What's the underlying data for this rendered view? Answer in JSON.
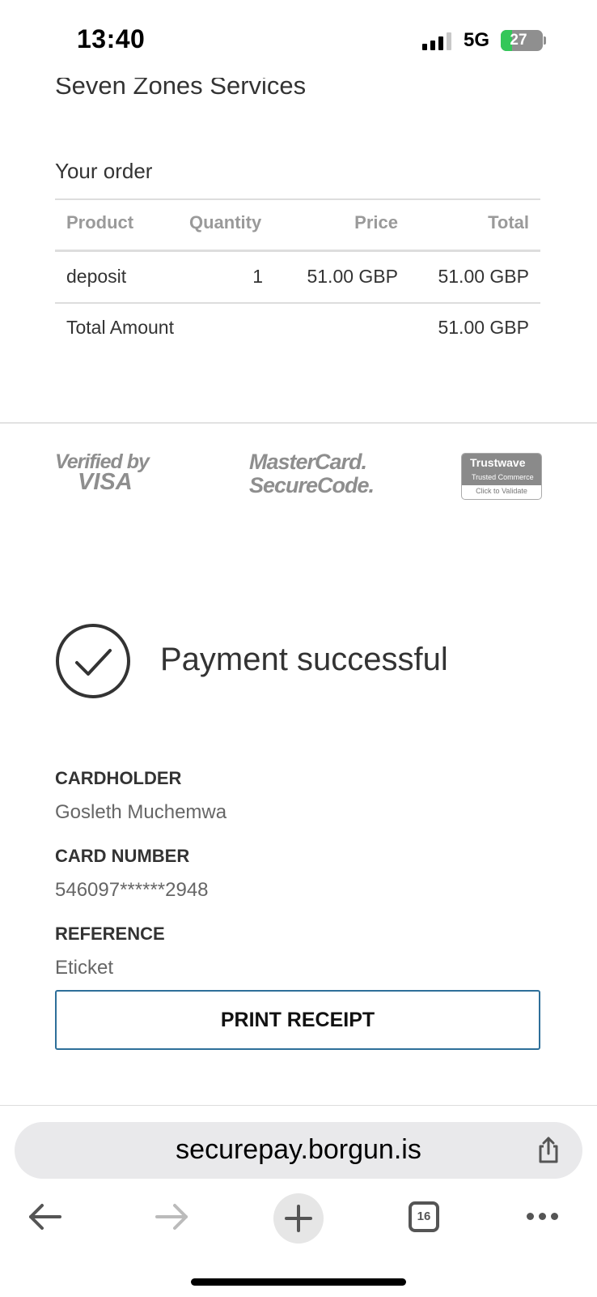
{
  "status_bar": {
    "time": "13:40",
    "network": "5G",
    "battery_level": 27,
    "battery_label": "27"
  },
  "merchant": {
    "name": "Seven Zones Services"
  },
  "order": {
    "title": "Your order",
    "columns": [
      "Product",
      "Quantity",
      "Price",
      "Total"
    ],
    "rows": [
      {
        "product": "deposit",
        "quantity": "1",
        "price": "51.00 GBP",
        "total": "51.00 GBP"
      }
    ],
    "total_label": "Total Amount",
    "total_value": "51.00 GBP"
  },
  "security_logos": {
    "visa": {
      "line1": "Verified by",
      "line2": "VISA"
    },
    "mastercard": {
      "line1": "MasterCard.",
      "line2": "SecureCode."
    },
    "trustwave": {
      "name": "Trustwave",
      "sub": "Trusted Commerce",
      "action": "Click to Validate"
    }
  },
  "payment": {
    "status": "Payment successful",
    "cardholder_label": "CARDHOLDER",
    "cardholder_value": "Gosleth Muchemwa",
    "card_number_label": "CARD NUMBER",
    "card_number_value": "546097******2948",
    "reference_label": "REFERENCE",
    "reference_value": "Eticket",
    "print_button": "PRINT RECEIPT"
  },
  "browser": {
    "url": "securepay.borgun.is",
    "tab_count": "16"
  },
  "colors": {
    "accent_border": "#2e6f99",
    "battery_green": "#34c759",
    "text": "#333333",
    "muted": "#9a9a9a"
  }
}
